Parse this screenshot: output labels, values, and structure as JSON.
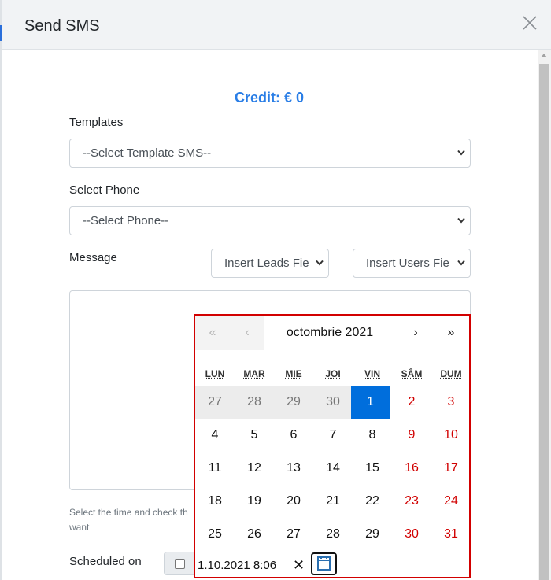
{
  "header": {
    "title": "Send SMS"
  },
  "credit": {
    "text": "Credit: € 0"
  },
  "templates": {
    "label": "Templates",
    "selected": "--Select Template SMS--"
  },
  "phone": {
    "label": "Select Phone",
    "selected": "--Select Phone--"
  },
  "message": {
    "label": "Message",
    "insert_leads": "Insert Leads Fie",
    "insert_users": "Insert Users Fie"
  },
  "help": {
    "line1": "Select the time and check th",
    "line2": "want"
  },
  "scheduled": {
    "label": "Scheduled on"
  },
  "datepicker": {
    "prev_year": "«",
    "prev_month": "‹",
    "month_label": "octombrie 2021",
    "next_month": "›",
    "next_year": "»",
    "weekdays": [
      "LUN",
      "MAR",
      "MIE",
      "JOI",
      "VIN",
      "SÂM",
      "DUM"
    ],
    "weeks": [
      [
        "27",
        "28",
        "29",
        "30",
        "1",
        "2",
        "3"
      ],
      [
        "4",
        "5",
        "6",
        "7",
        "8",
        "9",
        "10"
      ],
      [
        "11",
        "12",
        "13",
        "14",
        "15",
        "16",
        "17"
      ],
      [
        "18",
        "19",
        "20",
        "21",
        "22",
        "23",
        "24"
      ],
      [
        "25",
        "26",
        "27",
        "28",
        "29",
        "30",
        "31"
      ]
    ],
    "value": "1.10.2021 8:06",
    "clear": "✕"
  },
  "colors": {
    "accent": "#2a7ee6",
    "selected_day": "#006edc",
    "weekend": "#d10000",
    "highlight_border": "#d20000"
  }
}
